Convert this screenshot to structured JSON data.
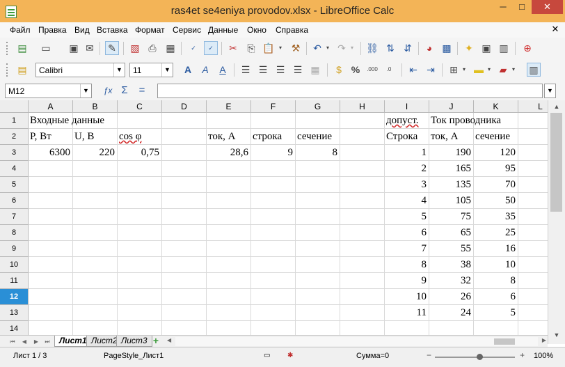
{
  "window": {
    "title": "ras4et se4eniya provodov.xlsx - LibreOffice Calc",
    "minimize": "─",
    "maximize": "□",
    "close": "✕"
  },
  "menu": [
    "Файл",
    "Правка",
    "Вид",
    "Вставка",
    "Формат",
    "Сервис",
    "Данные",
    "Окно",
    "Справка"
  ],
  "toolbar": {
    "font_name": "Calibri",
    "font_size": "11"
  },
  "formula_bar": {
    "name_box": "M12",
    "formula": ""
  },
  "columns": [
    "A",
    "B",
    "C",
    "D",
    "E",
    "F",
    "G",
    "H",
    "I",
    "J",
    "K",
    "L"
  ],
  "rows": [
    "1",
    "2",
    "3",
    "4",
    "5",
    "6",
    "7",
    "8",
    "9",
    "10",
    "11",
    "12",
    "13",
    "14"
  ],
  "active_row": "12",
  "cells": {
    "A1": "Входные данные",
    "I1": "допуст.",
    "J1": "Ток проводника",
    "A2": "P, Вт",
    "B2": "U, В",
    "C2": "cos φ",
    "E2": "ток, А",
    "F2": "строка",
    "G2": "сечение",
    "I2": "Строка",
    "J2": "ток, А",
    "K2": "сечение",
    "A3": "6300",
    "B3": "220",
    "C3": "0,75",
    "E3": "28,6",
    "F3": "9",
    "G3": "8",
    "I3": "1",
    "J3": "190",
    "K3": "120",
    "I4": "2",
    "J4": "165",
    "K4": "95",
    "I5": "3",
    "J5": "135",
    "K5": "70",
    "I6": "4",
    "J6": "105",
    "K6": "50",
    "I7": "5",
    "J7": "75",
    "K7": "35",
    "I8": "6",
    "J8": "65",
    "K8": "25",
    "I9": "7",
    "J9": "55",
    "K9": "16",
    "I10": "8",
    "J10": "38",
    "K10": "10",
    "I11": "9",
    "J11": "32",
    "K11": "8",
    "I12": "10",
    "J12": "26",
    "K12": "6",
    "I13": "11",
    "J13": "24",
    "K13": "5"
  },
  "sheets": [
    "Лист1",
    "Лист2",
    "Лист3"
  ],
  "active_sheet": "Лист1",
  "status": {
    "sheet_info": "Лист 1 / 3",
    "page_style": "PageStyle_Лист1",
    "sum": "Сумма=0",
    "zoom": "100%"
  }
}
